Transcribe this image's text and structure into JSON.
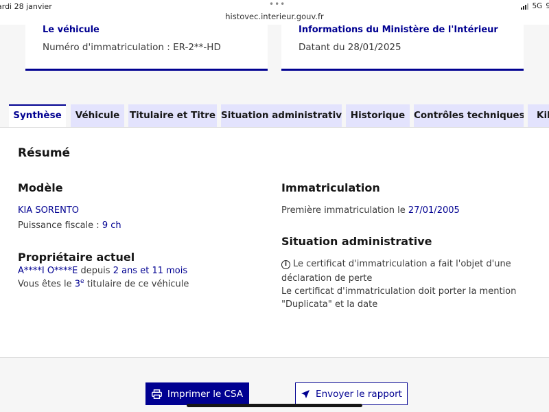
{
  "status_bar": {
    "date": "ardi 28 janvier",
    "dots": "•••",
    "url": "histovec.interieur.gouv.fr",
    "network": "5G",
    "battery": "9"
  },
  "cards": {
    "vehicle": {
      "title": "Le véhicule",
      "text": "Numéro d'immatriculation : ER-2**-HD"
    },
    "ministry": {
      "title": "Informations du Ministère de l'Intérieur",
      "text": "Datant du 28/01/2025"
    }
  },
  "tabs": [
    {
      "label": "Synthèse",
      "active": true
    },
    {
      "label": "Véhicule",
      "active": false
    },
    {
      "label": "Titulaire et Titre",
      "active": false
    },
    {
      "label": "Situation administrative",
      "active": false
    },
    {
      "label": "Historique",
      "active": false
    },
    {
      "label": "Contrôles techniques",
      "active": false
    },
    {
      "label": "Kilo",
      "active": false
    }
  ],
  "summary": {
    "title": "Résumé",
    "model": {
      "heading": "Modèle",
      "name": "KIA SORENTO",
      "power_label": "Puissance fiscale : ",
      "power_value": "9 ch"
    },
    "owner": {
      "heading": "Propriétaire actuel",
      "name": "A****I O****E",
      "since_label": " depuis ",
      "since_value": "2 ans et 11 mois",
      "rank_prefix": "Vous êtes le ",
      "rank_number": "3",
      "rank_sup": "e",
      "rank_suffix": " titulaire de ce véhicule"
    },
    "registration": {
      "heading": "Immatriculation",
      "first_label": "Première immatriculation le ",
      "first_date": "27/01/2005"
    },
    "admin": {
      "heading": "Situation administrative",
      "lines": [
        "Le certificat d'immatriculation a fait l'objet d'une",
        "déclaration de perte",
        "Le certificat d'immatriculation doit porter la mention",
        "\"Duplicata\" et la date"
      ]
    }
  },
  "buttons": {
    "print": "Imprimer le CSA",
    "send": "Envoyer le rapport"
  },
  "colors": {
    "primary": "#000091",
    "tab_background": "#e3e3fd"
  }
}
